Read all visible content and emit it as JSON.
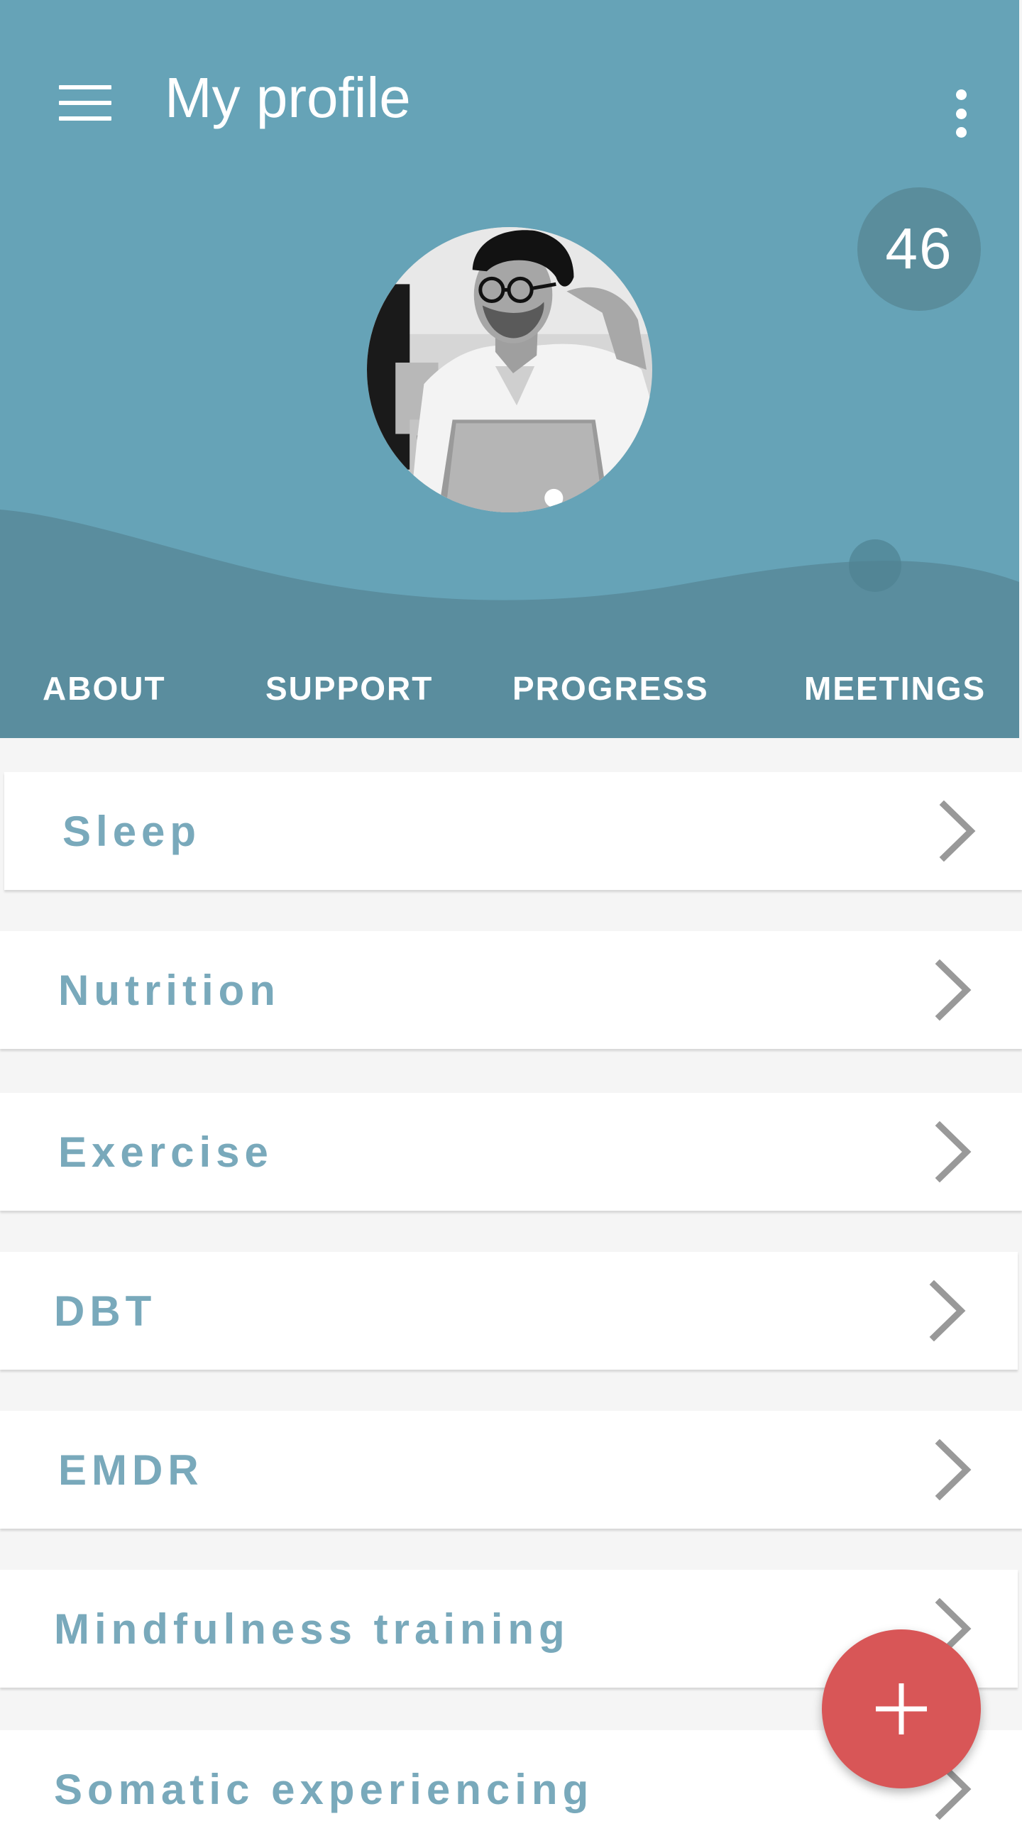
{
  "app_bar": {
    "title": "My profile",
    "menu_icon": "hamburger-menu-icon",
    "more_icon": "more-vertical-icon"
  },
  "profile": {
    "score": "46",
    "avatar": "user-avatar-photo"
  },
  "tabs": [
    {
      "label": "ABOUT"
    },
    {
      "label": "SUPPORT"
    },
    {
      "label": "PROGRESS"
    },
    {
      "label": "MEETINGS"
    }
  ],
  "list_items": [
    {
      "label": "Sleep"
    },
    {
      "label": "Nutrition"
    },
    {
      "label": "Exercise"
    },
    {
      "label": "DBT"
    },
    {
      "label": "EMDR"
    },
    {
      "label": "Mindfulness training"
    },
    {
      "label": "Somatic experiencing"
    }
  ],
  "fab": {
    "icon": "plus-icon"
  },
  "colors": {
    "header": "#66a3b7",
    "header_wave": "#5a8d9e",
    "score_badge": "#5a8d9c",
    "list_text": "#79a9bb",
    "chevron": "#999999",
    "fab": "#d85657",
    "page_background": "#f5f5f5"
  }
}
